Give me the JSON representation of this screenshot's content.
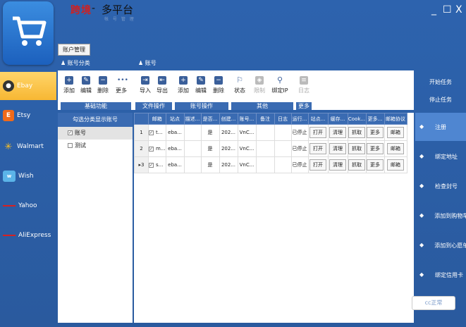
{
  "title": {
    "brand": "跨境",
    "dash": "-",
    "text": "多平台",
    "subtitle": "帐 号 管 理"
  },
  "window_controls": {
    "restore": "☐",
    "close": "X",
    "min": "_"
  },
  "tabs": {
    "account_mgmt": "账户管理"
  },
  "sections": {
    "left": "账号分类",
    "right": "账号"
  },
  "platforms": [
    {
      "name": "Ebay",
      "color": "#d63a2a",
      "active": true
    },
    {
      "name": "Etsy",
      "color": "#f06a1a"
    },
    {
      "name": "Walmart",
      "color": "#ffc220"
    },
    {
      "name": "Wish",
      "color": "#5bb4e8"
    },
    {
      "name": "Yahoo",
      "color": "#d62020"
    },
    {
      "name": "AliExpress",
      "color": "#d62020"
    }
  ],
  "ribbon": {
    "groups": [
      {
        "label": "基础功能",
        "buttons": [
          "添加",
          "编辑",
          "删除",
          "更多"
        ]
      },
      {
        "label": "文件操作",
        "buttons": [
          "导入",
          "导出"
        ]
      },
      {
        "label": "账号操作",
        "buttons": [
          "添加",
          "编辑",
          "删除"
        ]
      },
      {
        "label": "其他",
        "buttons": [
          "状态",
          "限制",
          "绑定IP"
        ]
      },
      {
        "label": "更多",
        "buttons": [
          "日志"
        ]
      }
    ]
  },
  "left_panel": {
    "header": "勾选分类显示账号",
    "items": [
      {
        "label": "账号",
        "checked": true
      },
      {
        "label": "测试",
        "checked": false
      }
    ]
  },
  "grid": {
    "columns": [
      "",
      "邮箱",
      "站点",
      "描述...",
      "是否...",
      "创建...",
      "账号...",
      "备注",
      "日志",
      "运行...",
      "站点...",
      "缓存...",
      "Cook...",
      "更多...",
      "邮箱协议"
    ],
    "rows": [
      {
        "num": "1",
        "email": "t...",
        "site": "eba...",
        "desc": "",
        "flag": "是",
        "created": "202...",
        "acct": "VnC...",
        "note": "",
        "log": "",
        "status": "已停止",
        "b1": "打开",
        "b2": "清理",
        "b3": "抓取",
        "b4": "更多",
        "b5": "邮箱"
      },
      {
        "num": "2",
        "email": "m...",
        "site": "eba...",
        "desc": "",
        "flag": "是",
        "created": "202...",
        "acct": "VnC...",
        "note": "",
        "log": "",
        "status": "已停止",
        "b1": "打开",
        "b2": "清理",
        "b3": "抓取",
        "b4": "更多",
        "b5": "邮箱"
      },
      {
        "num": "3",
        "email": "s...",
        "site": "eba...",
        "desc": "",
        "flag": "是",
        "created": "202...",
        "acct": "VnC...",
        "note": "",
        "log": "",
        "status": "已停止",
        "b1": "打开",
        "b2": "清理",
        "b3": "抓取",
        "b4": "更多",
        "b5": "邮箱"
      }
    ]
  },
  "right_panel": {
    "start_task": "开始任务",
    "stop_task": "停止任务",
    "actions": [
      "注册",
      "绑定地址",
      "检查封号",
      "添加到购物车",
      "添加到心愿单",
      "绑定信用卡"
    ],
    "status_button": "cc正常"
  }
}
